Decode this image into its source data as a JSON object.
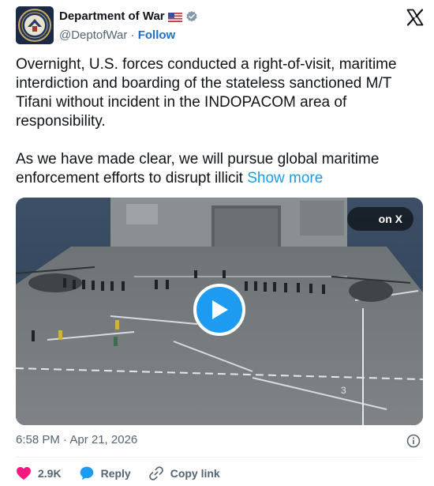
{
  "account": {
    "display_name": "Department of War",
    "handle": "@DeptofWar",
    "separator": "·",
    "follow_label": "Follow"
  },
  "tweet": {
    "paragraph_1": "Overnight, U.S. forces conducted a right-of-visit, maritime interdiction and boarding of the stateless sanctioned M/T Tifani without incident in the INDOPACOM area of responsibility.",
    "paragraph_2": "As we have made clear, we will pursue global maritime enforcement efforts to disrupt illicit",
    "show_more": "Show more"
  },
  "media": {
    "watch_label": "on X"
  },
  "meta": {
    "timestamp": "6:58 PM · Apr 21, 2026"
  },
  "actions": {
    "like_count": "2.9K",
    "reply_label": "Reply",
    "copy_link_label": "Copy link"
  },
  "colors": {
    "like": "#f91880",
    "reply": "#1d9bf0",
    "link": "#1d9bf0",
    "follow": "#1d6ec5"
  },
  "icons": {
    "platform": "x-logo-icon",
    "verified": "verified-badge-icon",
    "flag": "us-flag-icon",
    "like": "heart-icon",
    "reply": "reply-bubble-icon",
    "copy": "link-icon",
    "info": "info-icon",
    "play": "play-icon"
  }
}
